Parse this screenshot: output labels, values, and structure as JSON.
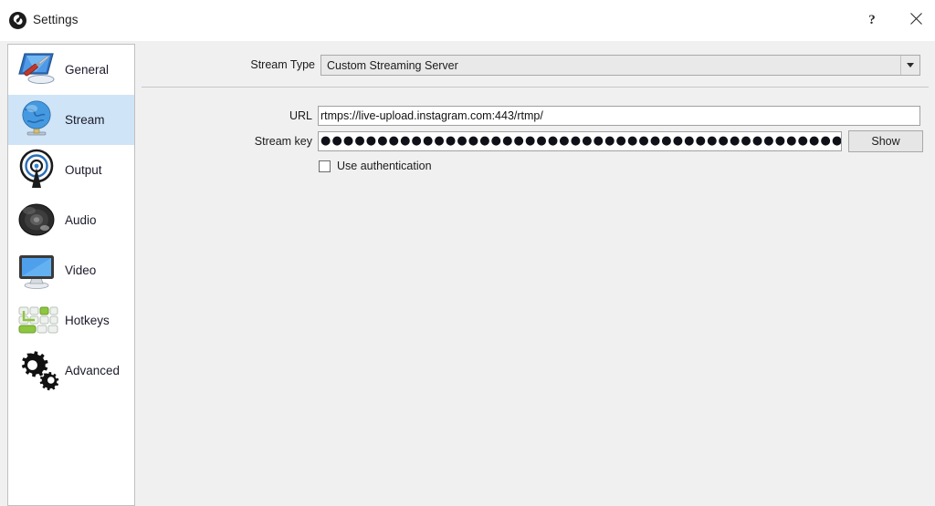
{
  "window": {
    "title": "Settings",
    "logo_icon": "obs-logo-icon",
    "help_button": "?",
    "help_icon": "question-mark-icon",
    "close_button": "×",
    "close_icon": "close-x-icon"
  },
  "sidebar": {
    "items": [
      {
        "id": "general",
        "label": "General",
        "icon": "monitor-screwdriver-icon",
        "selected": false
      },
      {
        "id": "stream",
        "label": "Stream",
        "icon": "globe-icon",
        "selected": true
      },
      {
        "id": "output",
        "label": "Output",
        "icon": "broadcast-antenna-icon",
        "selected": false
      },
      {
        "id": "audio",
        "label": "Audio",
        "icon": "speaker-icon",
        "selected": false
      },
      {
        "id": "video",
        "label": "Video",
        "icon": "monitor-icon",
        "selected": false
      },
      {
        "id": "hotkeys",
        "label": "Hotkeys",
        "icon": "keyboard-keys-icon",
        "selected": false
      },
      {
        "id": "advanced",
        "label": "Advanced",
        "icon": "gears-icon",
        "selected": false
      }
    ]
  },
  "stream_settings": {
    "stream_type": {
      "label": "Stream Type",
      "value": "Custom Streaming Server",
      "dropdown_icon": "chevron-down-icon"
    },
    "url": {
      "label": "URL",
      "value": "rtmps://live-upload.instagram.com:443/rtmp/"
    },
    "stream_key": {
      "label": "Stream key",
      "masked_value": "●●●●●●●●●●●●●●●●●●●●●●●●●●●●●●●●●●●●●●●●●●●●●●●●●●●●●●●●●●●●●●●●●●●●●●●●●●●●●●●●●●",
      "show_button": "Show"
    },
    "use_authentication": {
      "label": "Use authentication",
      "checked": false
    }
  },
  "colors": {
    "selection": "#cfe4f7",
    "panel_background": "#f0f0f0",
    "sidebar_background": "#ffffff",
    "border": "#c0c0c0"
  }
}
